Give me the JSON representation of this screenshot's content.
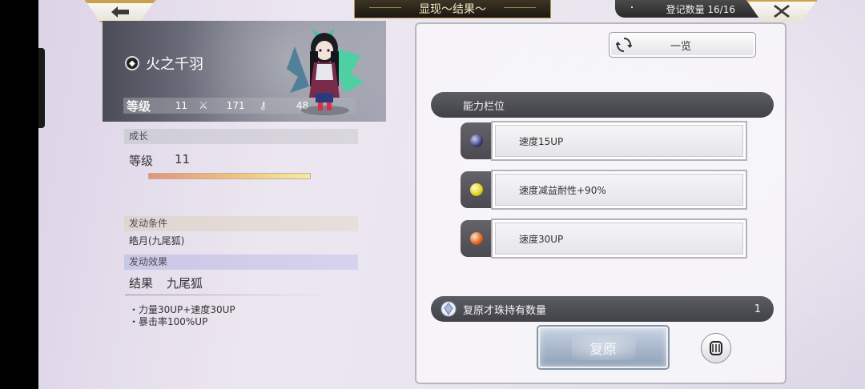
{
  "header": {
    "title": "显现～结果～",
    "count_label": "登记数量 16/16"
  },
  "character": {
    "name": "火之千羽",
    "level_label": "等级",
    "level": "11",
    "attack": "171",
    "key_stat": "48"
  },
  "growth": {
    "section": "成长",
    "level_label": "等级",
    "level": "11",
    "progress": 1.0
  },
  "condition": {
    "section": "发动条件",
    "text": "皓月(九尾狐)"
  },
  "effect": {
    "section": "发动效果",
    "result_label": "结果",
    "result_value": "九尾狐",
    "lines": [
      "・力量30UP+速度30UP",
      "・暴击率100%UP"
    ]
  },
  "right": {
    "list_button": "一览",
    "ability_header": "能力栏位",
    "slots": [
      {
        "label": "速度15UP",
        "gem_color": "#3a3f7a"
      },
      {
        "label": "速度减益耐性+90%",
        "gem_color": "#e3d21a"
      },
      {
        "label": "速度30UP",
        "gem_color": "#e0621a"
      }
    ],
    "orb_label": "复原才珠持有数量",
    "orb_count": "1",
    "restore_button": "复原"
  },
  "colors": {
    "accent_gold": "#c8a24e",
    "panel_dark": "#4a4a50"
  },
  "icons": {
    "back": "arrow-left-icon",
    "close": "close-x-icon",
    "refresh": "refresh-icon",
    "orb": "crystal-orb-icon",
    "gem_slot": "ornament-icon"
  }
}
